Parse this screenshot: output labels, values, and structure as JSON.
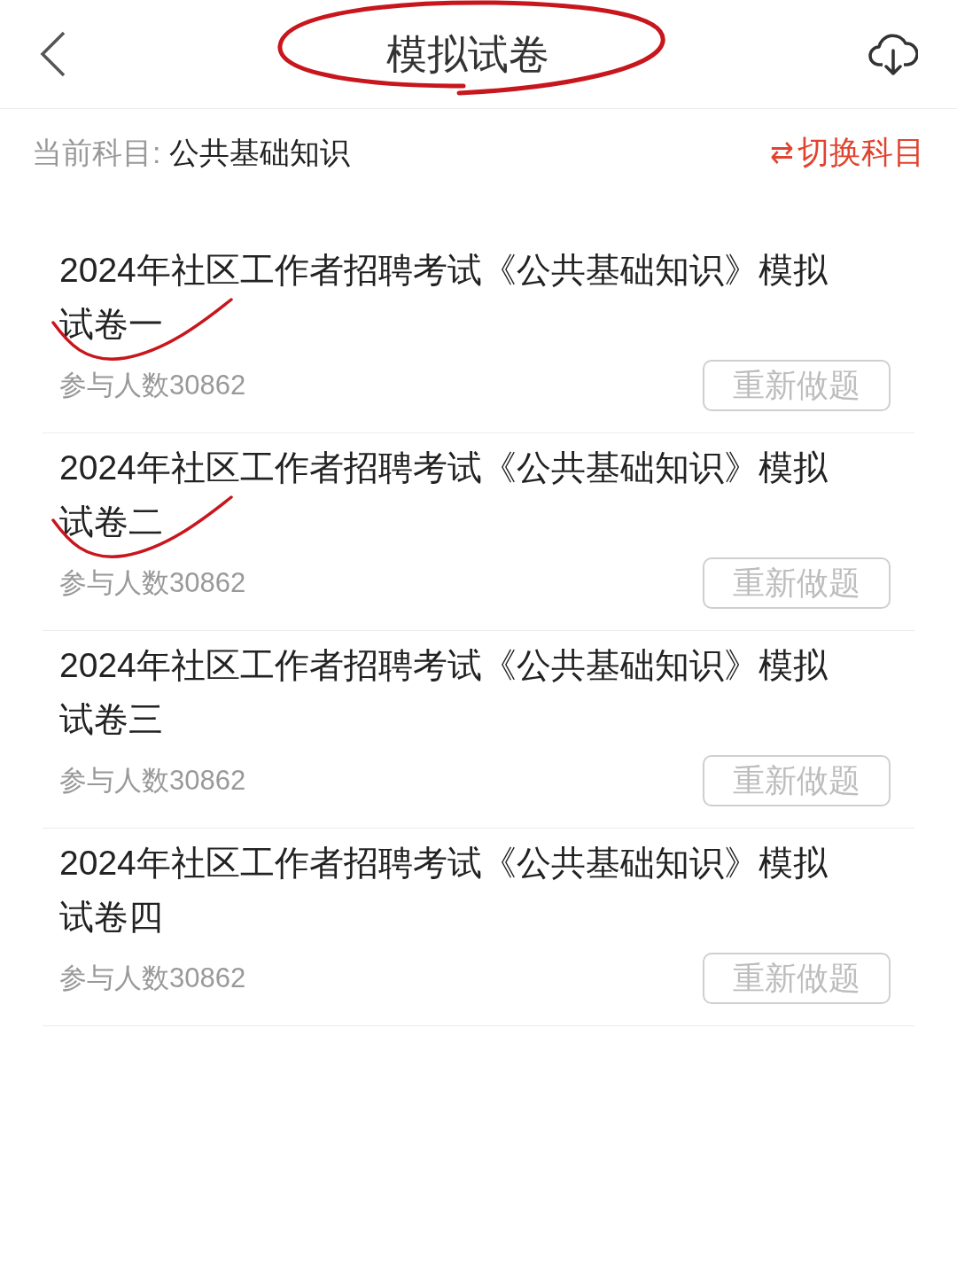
{
  "header": {
    "title": "模拟试卷",
    "title_circled": true
  },
  "subject": {
    "label": "当前科目:",
    "value": "公共基础知识",
    "switch_icon": "⇄",
    "switch_label": "切换科目"
  },
  "papers": [
    {
      "title": "2024年社区工作者招聘考试《公共基础知识》模拟试卷一",
      "participants": "参与人数30862",
      "button": "重新做题",
      "ticked": true
    },
    {
      "title": "2024年社区工作者招聘考试《公共基础知识》模拟试卷二",
      "participants": "参与人数30862",
      "button": "重新做题",
      "ticked": true
    },
    {
      "title": "2024年社区工作者招聘考试《公共基础知识》模拟试卷三",
      "participants": "参与人数30862",
      "button": "重新做题",
      "ticked": false
    },
    {
      "title": "2024年社区工作者招聘考试《公共基础知识》模拟试卷四",
      "participants": "参与人数30862",
      "button": "重新做题",
      "ticked": false
    }
  ]
}
